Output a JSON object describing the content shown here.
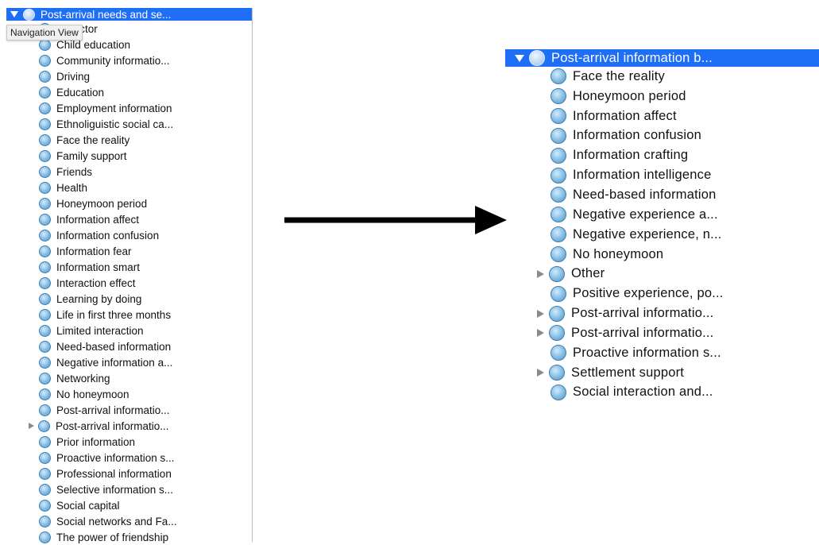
{
  "tooltip": "Navigation View",
  "left_tree": {
    "root": "Post-arrival needs and se...",
    "items": [
      {
        "label": "ve factor",
        "expandable": false
      },
      {
        "label": "Child education",
        "expandable": false
      },
      {
        "label": "Community informatio...",
        "expandable": false
      },
      {
        "label": "Driving",
        "expandable": false
      },
      {
        "label": "Education",
        "expandable": false
      },
      {
        "label": "Employment information",
        "expandable": false
      },
      {
        "label": "Ethnoliguistic social ca...",
        "expandable": false
      },
      {
        "label": "Face the reality",
        "expandable": false
      },
      {
        "label": "Family support",
        "expandable": false
      },
      {
        "label": "Friends",
        "expandable": false
      },
      {
        "label": "Health",
        "expandable": false
      },
      {
        "label": "Honeymoon period",
        "expandable": false
      },
      {
        "label": "Information affect",
        "expandable": false
      },
      {
        "label": "Information confusion",
        "expandable": false
      },
      {
        "label": "Information fear",
        "expandable": false
      },
      {
        "label": "Information smart",
        "expandable": false
      },
      {
        "label": "Interaction effect",
        "expandable": false
      },
      {
        "label": "Learning by doing",
        "expandable": false
      },
      {
        "label": "Life in first three months",
        "expandable": false
      },
      {
        "label": "Limited interaction",
        "expandable": false
      },
      {
        "label": "Need-based information",
        "expandable": false
      },
      {
        "label": "Negative information a...",
        "expandable": false
      },
      {
        "label": "Networking",
        "expandable": false
      },
      {
        "label": "No honeymoon",
        "expandable": false
      },
      {
        "label": "Post-arrival informatio...",
        "expandable": false
      },
      {
        "label": "Post-arrival informatio...",
        "expandable": true
      },
      {
        "label": "Prior information",
        "expandable": false
      },
      {
        "label": "Proactive information s...",
        "expandable": false
      },
      {
        "label": "Professional information",
        "expandable": false
      },
      {
        "label": "Selective information s...",
        "expandable": false
      },
      {
        "label": "Social capital",
        "expandable": false
      },
      {
        "label": "Social networks and Fa...",
        "expandable": false
      },
      {
        "label": "The power of friendship",
        "expandable": false
      }
    ]
  },
  "right_tree": {
    "root": "Post-arrival information b...",
    "items": [
      {
        "label": "Face the reality",
        "expandable": false
      },
      {
        "label": "Honeymoon period",
        "expandable": false
      },
      {
        "label": "Information affect",
        "expandable": false
      },
      {
        "label": "Information confusion",
        "expandable": false
      },
      {
        "label": "Information crafting",
        "expandable": false
      },
      {
        "label": "Information intelligence",
        "expandable": false
      },
      {
        "label": "Need-based information",
        "expandable": false
      },
      {
        "label": "Negative experience a...",
        "expandable": false
      },
      {
        "label": "Negative experience, n...",
        "expandable": false
      },
      {
        "label": "No honeymoon",
        "expandable": false
      },
      {
        "label": "Other",
        "expandable": true
      },
      {
        "label": "Positive experience, po...",
        "expandable": false
      },
      {
        "label": "Post-arrival informatio...",
        "expandable": true
      },
      {
        "label": "Post-arrival informatio...",
        "expandable": true
      },
      {
        "label": "Proactive information s...",
        "expandable": false
      },
      {
        "label": "Settlement support",
        "expandable": true
      },
      {
        "label": "Social interaction and...",
        "expandable": false
      }
    ]
  },
  "colors": {
    "selection": "#1e6ef6",
    "node_icon": "#8fc4e8",
    "arrow": "#000000"
  },
  "icons": {
    "node": "node-circle-icon",
    "disclosure": "disclosure-triangle-icon",
    "arrow": "right-arrow-icon"
  }
}
